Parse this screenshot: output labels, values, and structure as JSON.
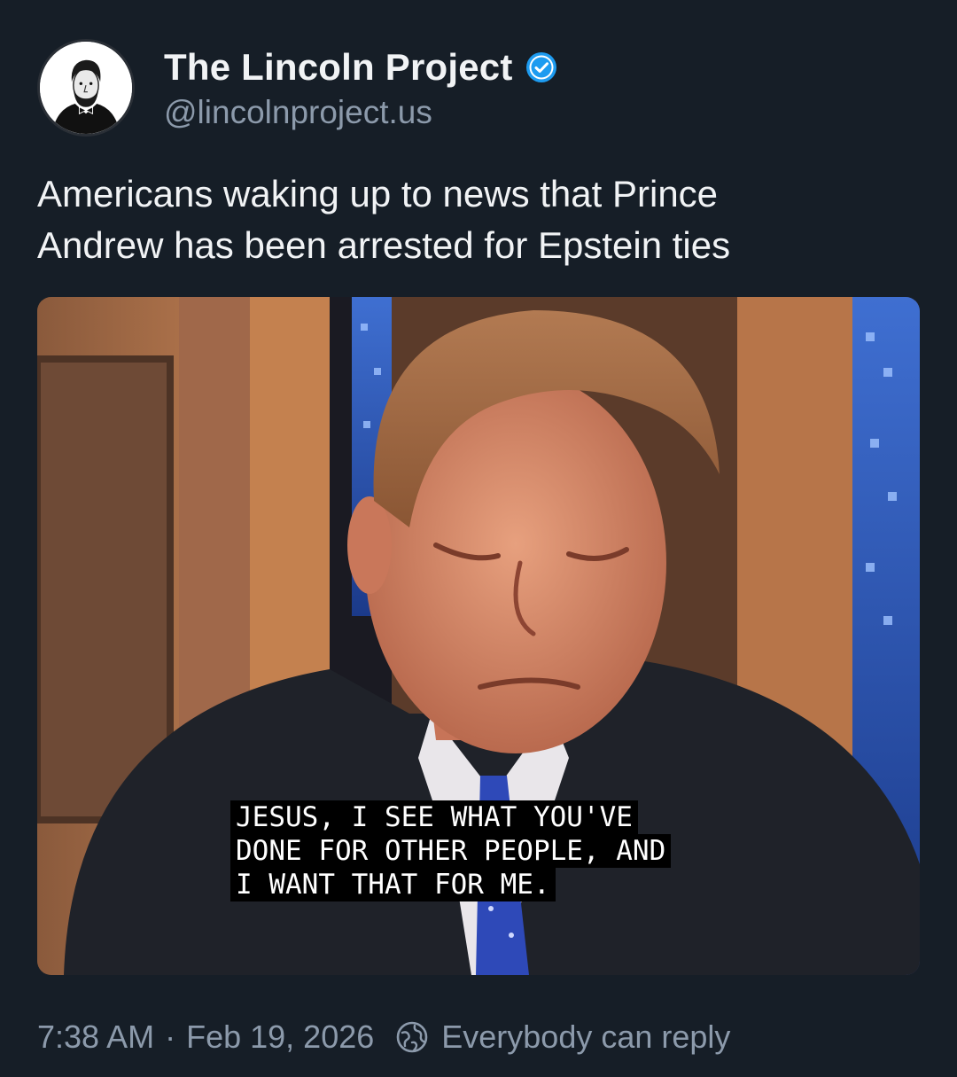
{
  "post": {
    "author": {
      "display_name": "The Lincoln Project",
      "handle": "@lincolnproject.us",
      "verified": true,
      "avatar_icon": "lincoln-portrait-icon"
    },
    "text_lines": [
      "Americans waking up to news that Prince",
      "Andrew has been arrested for Epstein ties"
    ],
    "media": {
      "caption_lines": [
        "JESUS, I SEE WHAT YOU'VE",
        "DONE FOR OTHER PEOPLE, AND",
        "I WANT THAT FOR ME."
      ]
    },
    "footer": {
      "time": "7:38 AM",
      "separator": "·",
      "date": "Feb 19, 2026",
      "reply_setting": "Everybody can reply",
      "reply_icon": "globe-icon"
    }
  },
  "colors": {
    "background": "#161e27",
    "primary_text": "#f1f3f5",
    "secondary_text": "#8c9aab",
    "verified_badge": "#1d9bf0"
  }
}
